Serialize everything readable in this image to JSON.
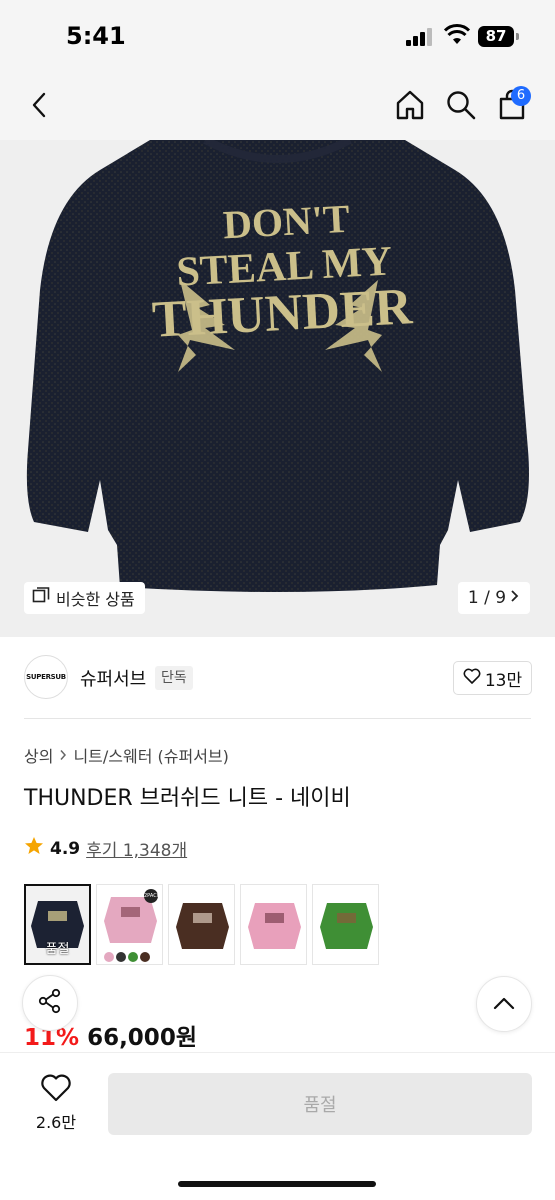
{
  "status_bar": {
    "time": "5:41",
    "battery": "87"
  },
  "nav": {
    "cart_badge": "6"
  },
  "icons": [
    "back-icon",
    "home-icon",
    "search-icon",
    "cart-icon",
    "similar-icon",
    "chevron-right-icon",
    "heart-icon",
    "star-icon",
    "share-icon",
    "chevron-up-icon"
  ],
  "image": {
    "sweater_text_line1": "DON'T",
    "sweater_text_line2": "STEAL MY",
    "sweater_text_line3": "THUNDER",
    "similar_label": "비슷한 상품",
    "pager": "1 / 9"
  },
  "brand": {
    "logo_text": "SUPERSUB",
    "name": "슈퍼서브",
    "tag": "단독",
    "likes": "13만"
  },
  "breadcrumb": {
    "category": "상의",
    "subcategory": "니트/스웨터 (슈퍼서브)"
  },
  "product": {
    "title": "THUNDER 브러쉬드 니트 - 네이비",
    "rating": "4.9",
    "reviews": "후기 1,348개",
    "variants": [
      {
        "color": "#1c2233",
        "soldout": "품절",
        "selected": true
      },
      {
        "color": "#e4a8c0",
        "pack": "2PACK"
      },
      {
        "color": "#4a2e22"
      },
      {
        "color": "#e8a0bb"
      },
      {
        "color": "#3f8f35"
      }
    ],
    "original_price_suffix": "원",
    "discount": "11%",
    "price": "66,000원"
  },
  "bottom": {
    "wish_count": "2.6만",
    "buy_label": "품절"
  },
  "colors": {
    "accent": "#1f6bff",
    "discount": "#f31a1a",
    "sweater": "#1a2030",
    "lettering": "#cbbf8a"
  }
}
